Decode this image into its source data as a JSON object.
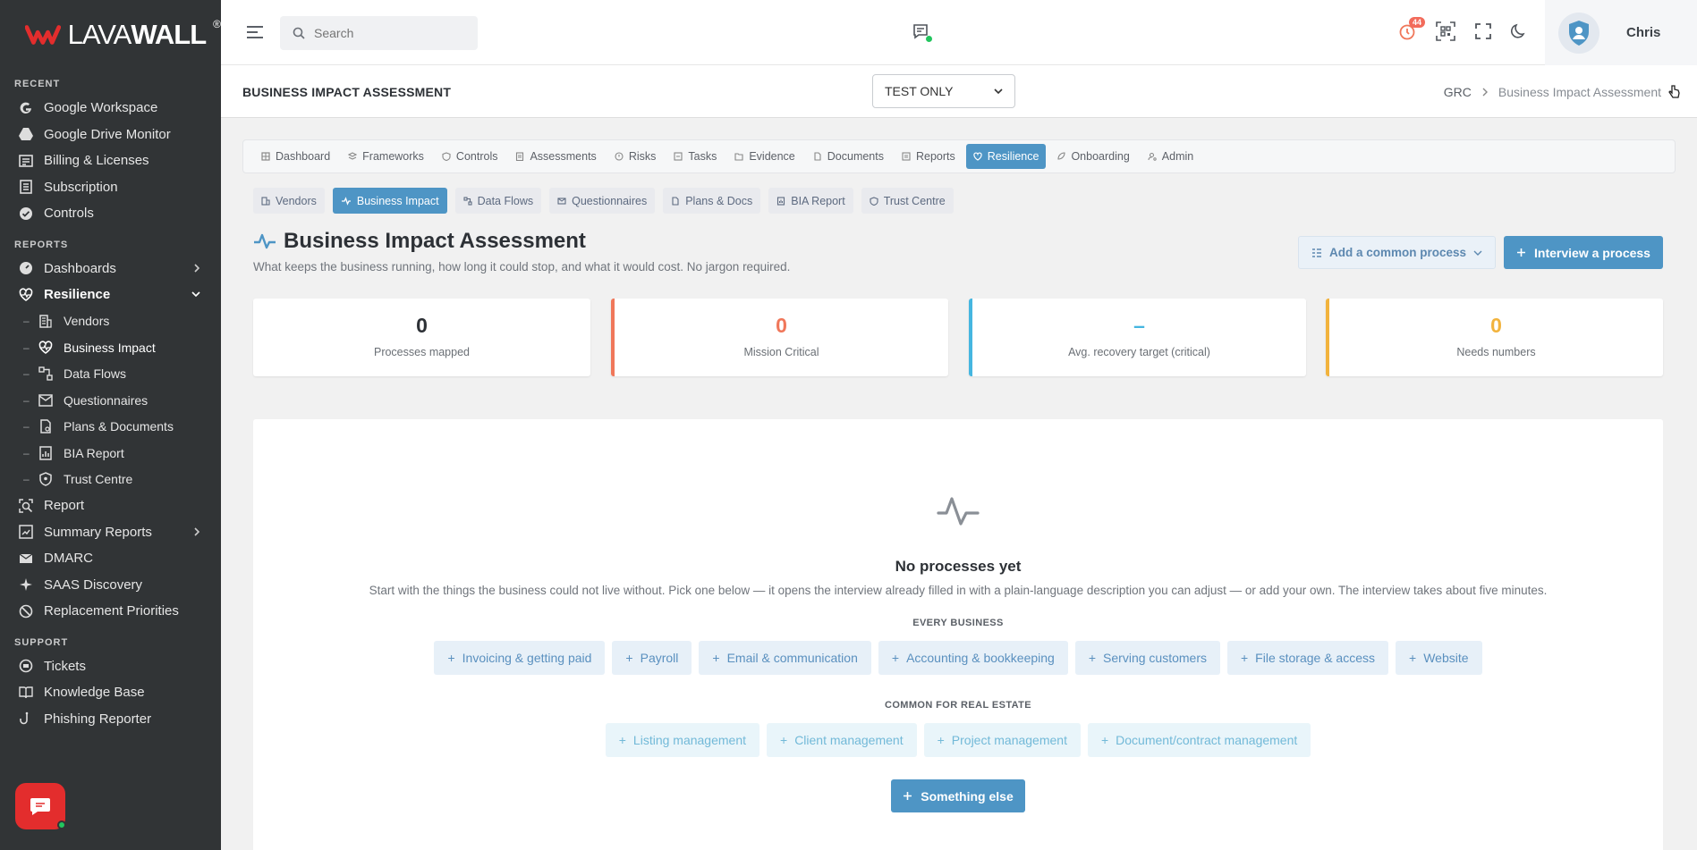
{
  "brand": {
    "logo_text_a": "LAVA",
    "logo_text_b": "WALL",
    "reg": "®"
  },
  "sidebar": {
    "recent_label": "RECENT",
    "recent": [
      {
        "label": "Google Workspace",
        "icon": "google-icon"
      },
      {
        "label": "Google Drive Monitor",
        "icon": "drive-icon"
      },
      {
        "label": "Billing & Licenses",
        "icon": "billing-icon"
      },
      {
        "label": "Subscription",
        "icon": "subscription-icon"
      },
      {
        "label": "Controls",
        "icon": "controls-icon"
      }
    ],
    "reports_label": "REPORTS",
    "reports": [
      {
        "label": "Dashboards",
        "icon": "dashboard-icon"
      },
      {
        "label": "Resilience",
        "icon": "heart-pulse-icon"
      }
    ],
    "resilience_sub": [
      {
        "label": "Vendors",
        "icon": "building-icon"
      },
      {
        "label": "Business Impact",
        "icon": "heart-pulse-icon"
      },
      {
        "label": "Data Flows",
        "icon": "flow-icon"
      },
      {
        "label": "Questionnaires",
        "icon": "questionnaire-icon"
      },
      {
        "label": "Plans & Documents",
        "icon": "document-icon"
      },
      {
        "label": "BIA Report",
        "icon": "report-icon"
      },
      {
        "label": "Trust Centre",
        "icon": "shield-icon"
      }
    ],
    "reports_more": [
      {
        "label": "Report",
        "icon": "search-report-icon"
      },
      {
        "label": "Summary Reports",
        "icon": "summary-icon"
      },
      {
        "label": "DMARC",
        "icon": "mail-check-icon"
      },
      {
        "label": "SAAS Discovery",
        "icon": "sparkle-icon"
      },
      {
        "label": "Replacement Priorities",
        "icon": "priority-icon"
      }
    ],
    "support_label": "SUPPORT",
    "support": [
      {
        "label": "Tickets",
        "icon": "ticket-icon"
      },
      {
        "label": "Knowledge Base",
        "icon": "book-icon"
      },
      {
        "label": "Phishing Reporter",
        "icon": "hook-icon"
      }
    ]
  },
  "topbar": {
    "search_placeholder": "Search",
    "notification_count": "44",
    "user_name": "Chris"
  },
  "page_header": {
    "title": "BUSINESS IMPACT ASSESSMENT",
    "env_select": "TEST ONLY",
    "breadcrumb": [
      "GRC",
      "Business Impact Assessment"
    ]
  },
  "tabs": [
    {
      "label": "Dashboard"
    },
    {
      "label": "Frameworks"
    },
    {
      "label": "Controls"
    },
    {
      "label": "Assessments"
    },
    {
      "label": "Risks"
    },
    {
      "label": "Tasks"
    },
    {
      "label": "Evidence"
    },
    {
      "label": "Documents"
    },
    {
      "label": "Reports"
    },
    {
      "label": "Resilience"
    },
    {
      "label": "Onboarding"
    },
    {
      "label": "Admin"
    }
  ],
  "subtabs": [
    {
      "label": "Vendors"
    },
    {
      "label": "Business Impact"
    },
    {
      "label": "Data Flows"
    },
    {
      "label": "Questionnaires"
    },
    {
      "label": "Plans & Docs"
    },
    {
      "label": "BIA Report"
    },
    {
      "label": "Trust Centre"
    }
  ],
  "heading": {
    "title": "Business Impact Assessment",
    "subtitle": "What keeps the business running, how long it could stop, and what it would cost. No jargon required.",
    "add_common": "Add a common process",
    "interview": "Interview a process"
  },
  "stats": [
    {
      "value": "0",
      "label": "Processes mapped",
      "color": "#2d3136"
    },
    {
      "value": "0",
      "label": "Mission Critical",
      "color": "#f0775a"
    },
    {
      "value": "–",
      "label": "Avg. recovery target (critical)",
      "color": "#45b6e0"
    },
    {
      "value": "0",
      "label": "Needs numbers",
      "color": "#f2b33d"
    }
  ],
  "empty": {
    "title": "No processes yet",
    "desc": "Start with the things the business could not live without. Pick one below — it opens the interview already filled in with a plain-language description you can adjust — or add your own. The interview takes about five minutes.",
    "every_label": "EVERY BUSINESS",
    "every": [
      "Invoicing & getting paid",
      "Payroll",
      "Email & communication",
      "Accounting & bookkeeping",
      "Serving customers",
      "File storage & access",
      "Website"
    ],
    "realestate_label": "COMMON FOR REAL ESTATE",
    "realestate": [
      "Listing management",
      "Client management",
      "Project management",
      "Document/contract management"
    ],
    "something_else": "Something else"
  },
  "colors": {
    "accent": "#4e95c5",
    "sidebar_bg": "#313436",
    "brand_red": "#e32d2d"
  }
}
